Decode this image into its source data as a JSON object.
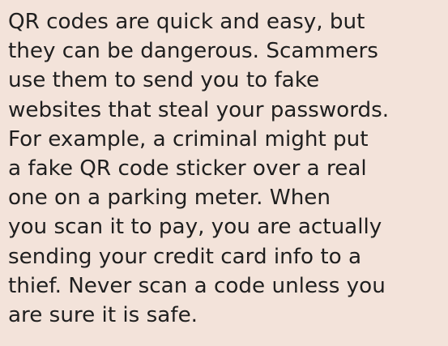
{
  "article": {
    "body": "QR codes are quick and easy, but\nthey can be dangerous. Scammers\nuse them to send you to fake\nwebsites that steal your passwords.\nFor example, a criminal might put\na fake QR code sticker over a real\none on a parking meter. When\nyou scan it to pay, you are actually\nsending your credit card info to a\nthief. Never scan a code unless you\nare sure it is safe."
  },
  "colors": {
    "background": "#f3e3da",
    "text": "#1f1f1f"
  }
}
